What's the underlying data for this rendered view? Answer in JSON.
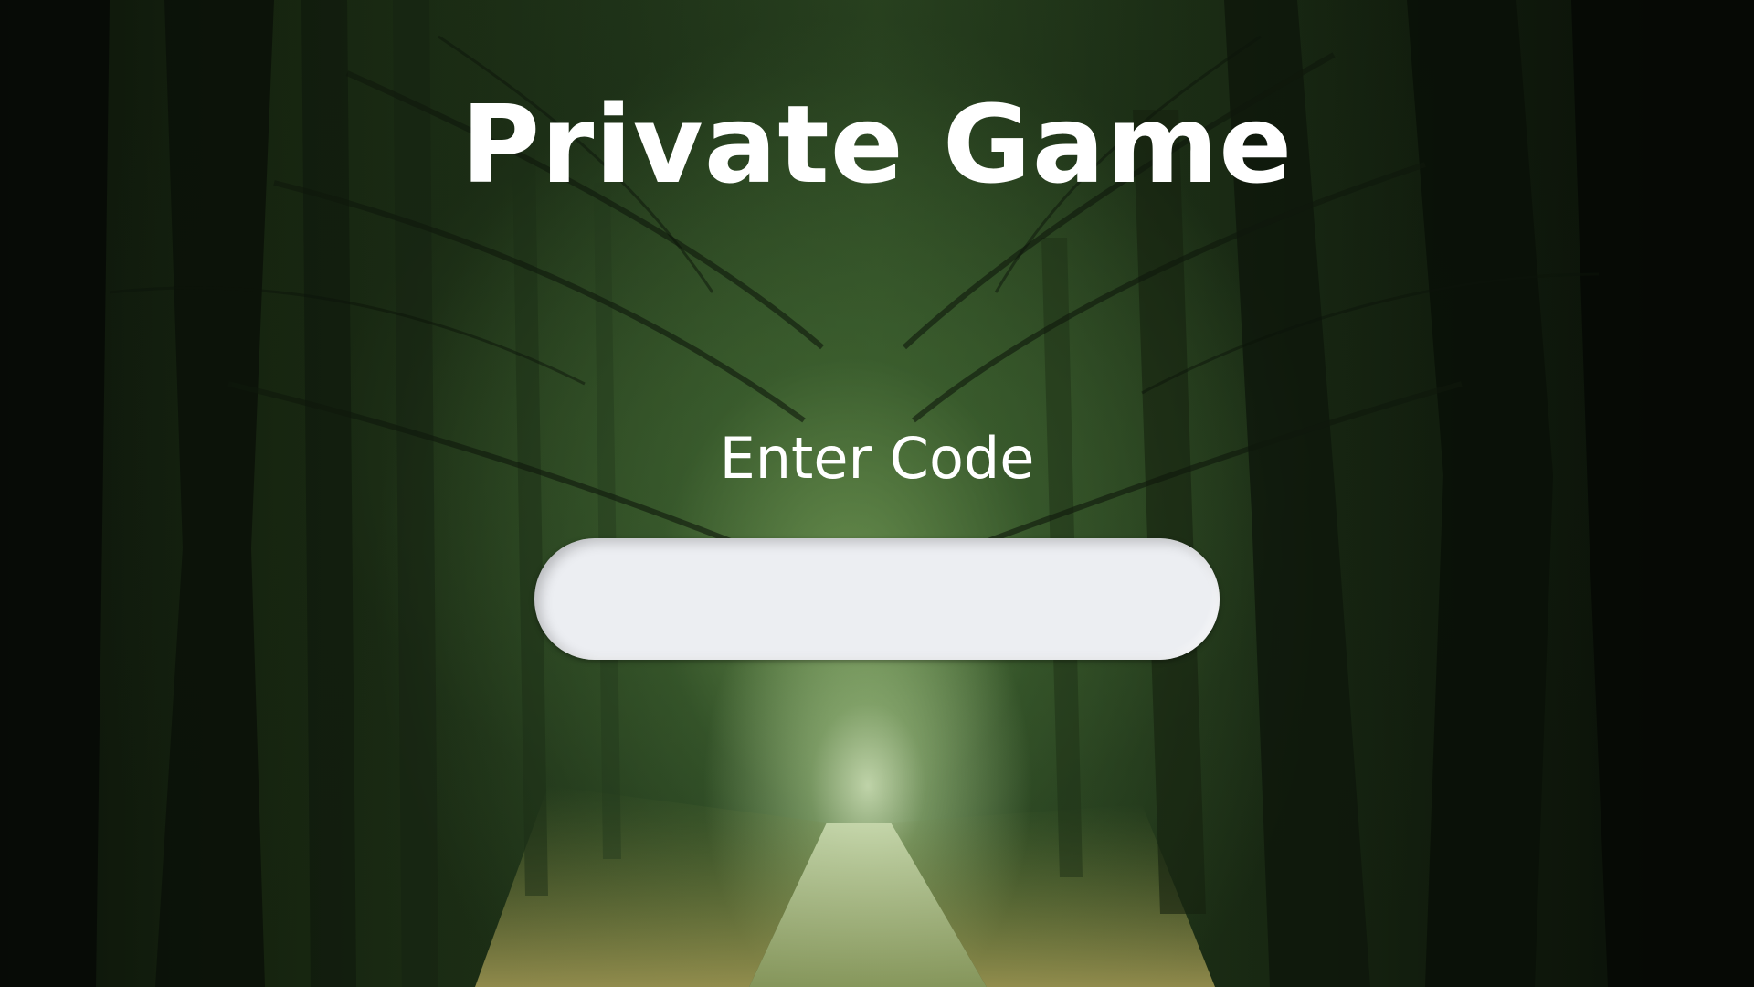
{
  "screen": {
    "title": "Private Game",
    "code_label": "Enter Code",
    "code_input": {
      "value": "",
      "placeholder": ""
    }
  },
  "background": {
    "scene": "dark-forest-path",
    "accent_color": "#2a4420",
    "light_color": "#d6e8be"
  }
}
